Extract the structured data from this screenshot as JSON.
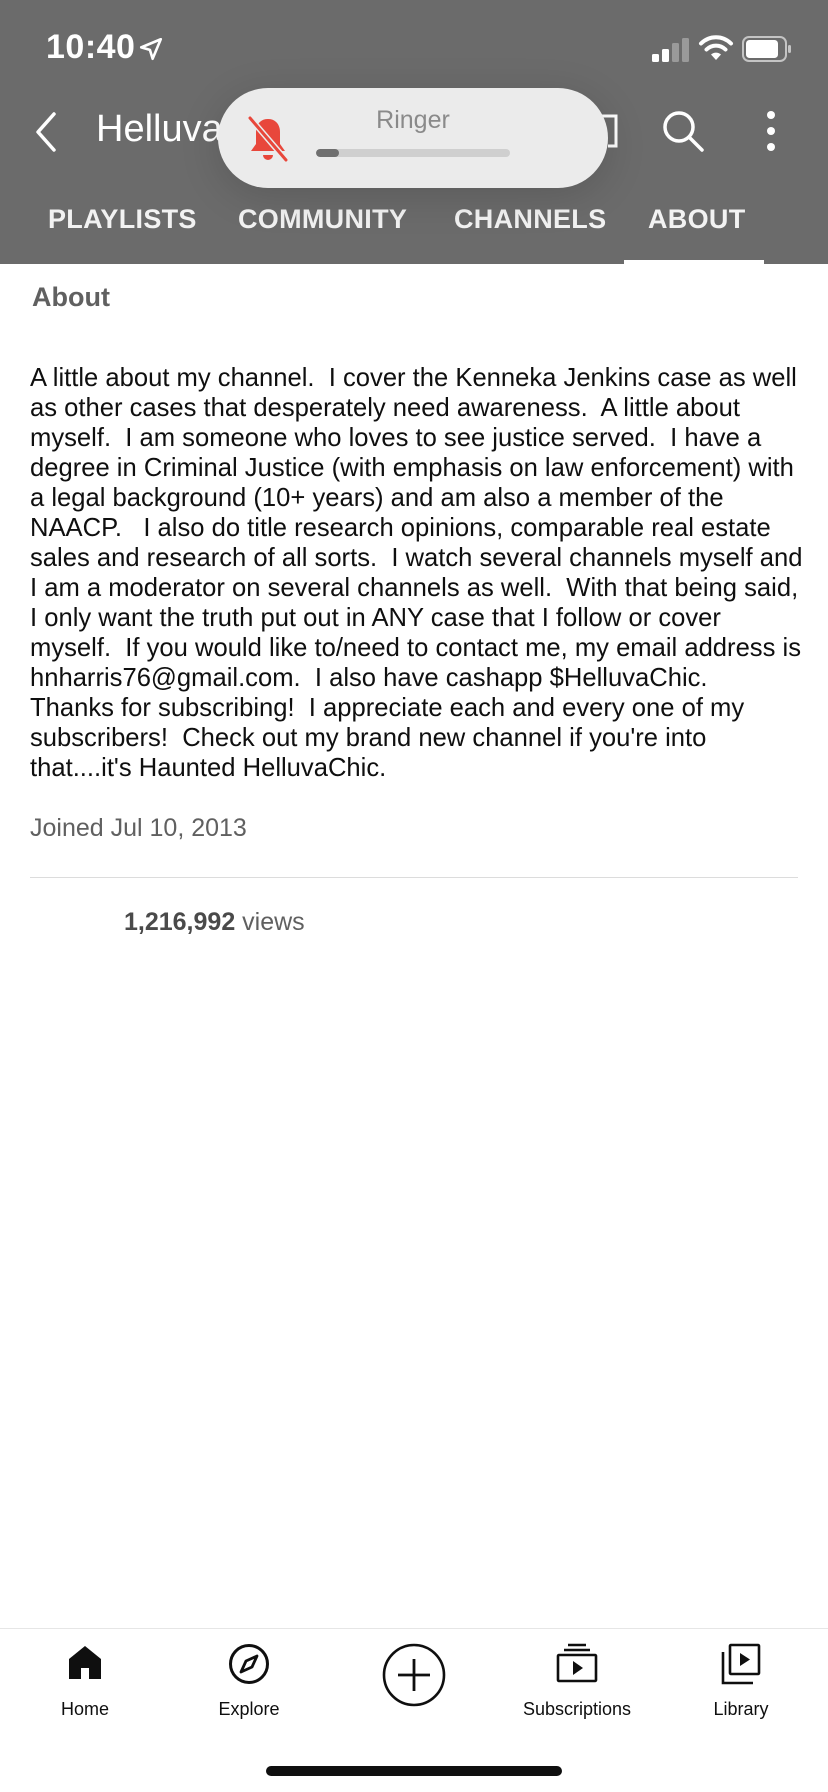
{
  "status_bar": {
    "time": "10:40"
  },
  "header": {
    "channel_title": "HelluvaChic",
    "tabs": [
      {
        "label": "PLAYLISTS"
      },
      {
        "label": "COMMUNITY"
      },
      {
        "label": "CHANNELS"
      },
      {
        "label": "ABOUT",
        "selected": true
      }
    ]
  },
  "ringer_overlay": {
    "label": "Ringer",
    "level": 0.12,
    "muted": true
  },
  "about": {
    "section_label": "About",
    "description": "A little about my channel.  I cover the Kenneka Jenkins case as well as other cases that desperately need awareness.  A little about myself.  I am someone who loves to see justice served.  I have a degree in Criminal Justice (with emphasis on law enforcement) with a legal background (10+ years) and am also a member of the NAACP.   I also do title research opinions, comparable real estate sales and research of all sorts.  I watch several channels myself and I am a moderator on several channels as well.  With that being said, I only want the truth put out in ANY case that I follow or cover myself.  If you would like to/need to contact me, my email address is hnharris76@gmail.com.  I also have cashapp $HelluvaChic.   Thanks for subscribing!  I appreciate each and every one of my subscribers!  Check out my brand new channel if you're into that....it's Haunted HelluvaChic.",
    "joined": "Joined Jul 10, 2013",
    "views_count": "1,216,992",
    "views_suffix": " views"
  },
  "bottom_nav": {
    "items": [
      {
        "label": "Home",
        "icon": "home-icon"
      },
      {
        "label": "Explore",
        "icon": "explore-icon"
      },
      {
        "label": "",
        "icon": "create-icon"
      },
      {
        "label": "Subscriptions",
        "icon": "subscriptions-icon"
      },
      {
        "label": "Library",
        "icon": "library-icon"
      }
    ]
  }
}
